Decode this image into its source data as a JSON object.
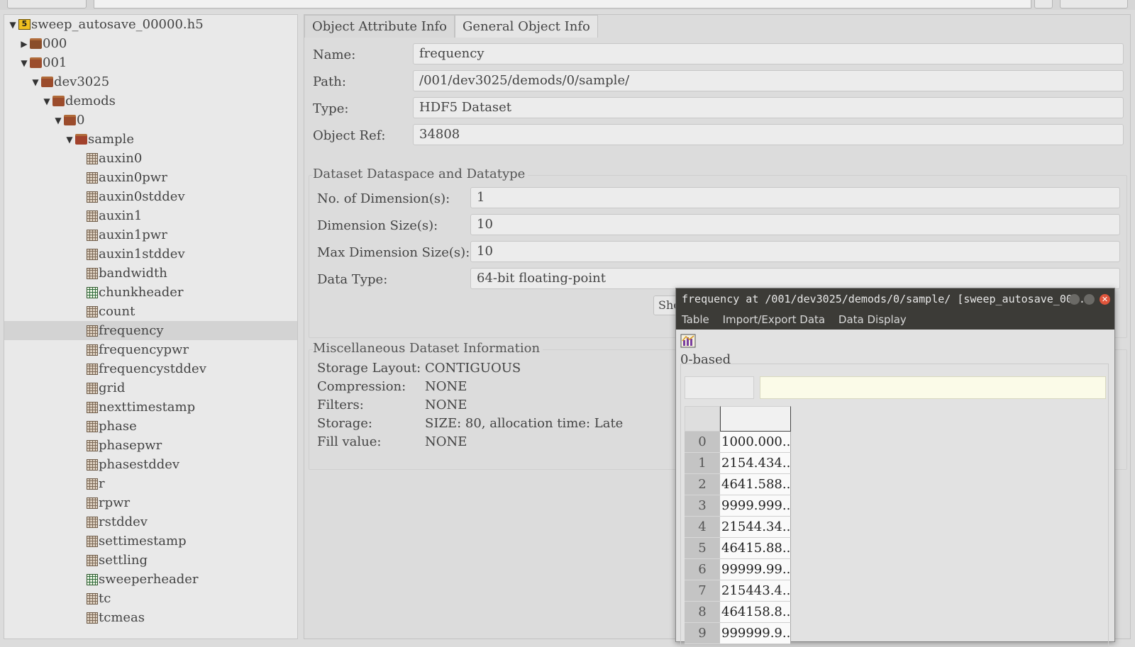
{
  "tree": {
    "root": "sweep_autosave_00000.h5",
    "items": [
      {
        "label": "000"
      },
      {
        "label": "001"
      },
      {
        "label": "dev3025"
      },
      {
        "label": "demods"
      },
      {
        "label": "0"
      },
      {
        "label": "sample"
      },
      {
        "label": "auxin0"
      },
      {
        "label": "auxin0pwr"
      },
      {
        "label": "auxin0stddev"
      },
      {
        "label": "auxin1"
      },
      {
        "label": "auxin1pwr"
      },
      {
        "label": "auxin1stddev"
      },
      {
        "label": "bandwidth"
      },
      {
        "label": "chunkheader"
      },
      {
        "label": "count"
      },
      {
        "label": "frequency"
      },
      {
        "label": "frequencypwr"
      },
      {
        "label": "frequencystddev"
      },
      {
        "label": "grid"
      },
      {
        "label": "nexttimestamp"
      },
      {
        "label": "phase"
      },
      {
        "label": "phasepwr"
      },
      {
        "label": "phasestddev"
      },
      {
        "label": "r"
      },
      {
        "label": "rpwr"
      },
      {
        "label": "rstddev"
      },
      {
        "label": "settimestamp"
      },
      {
        "label": "settling"
      },
      {
        "label": "sweeperheader"
      },
      {
        "label": "tc"
      },
      {
        "label": "tcmeas"
      }
    ]
  },
  "tabs": [
    "Object Attribute Info",
    "General Object Info"
  ],
  "object": {
    "name_label": "Name:",
    "name_value": "frequency",
    "path_label": "Path:",
    "path_value": "/001/dev3025/demods/0/sample/",
    "type_label": "Type:",
    "type_value": "HDF5 Dataset",
    "ref_label": "Object Ref:",
    "ref_value": "34808"
  },
  "dataspace": {
    "title": "Dataset Dataspace and Datatype",
    "ndims_label": "No. of Dimension(s):",
    "ndims_value": "1",
    "dims_label": "Dimension Size(s):",
    "dims_value": "10",
    "maxdims_label": "Max Dimension Size(s):",
    "maxdims_value": "10",
    "dtype_label": "Data Type:",
    "dtype_value": "64-bit floating-point",
    "show_button": "Sho"
  },
  "misc": {
    "title": "Miscellaneous Dataset Information",
    "layout_label": "Storage Layout:",
    "layout_value": "CONTIGUOUS",
    "compression_label": "Compression:",
    "compression_value": "NONE",
    "filters_label": "Filters:",
    "filters_value": "NONE",
    "storage_label": "Storage:",
    "storage_value": "SIZE: 80, allocation time: Late",
    "fill_label": "Fill value:",
    "fill_value": "NONE"
  },
  "window": {
    "title": "frequency  at  /001/dev3025/demods/0/sample/  [sweep_autosave_00...",
    "menu": [
      "Table",
      "Import/Export Data",
      "Data Display"
    ],
    "base_label": "0-based",
    "rows": [
      {
        "index": "0",
        "value": "1000.000..."
      },
      {
        "index": "1",
        "value": "2154.434..."
      },
      {
        "index": "2",
        "value": "4641.588..."
      },
      {
        "index": "3",
        "value": "9999.999..."
      },
      {
        "index": "4",
        "value": "21544.34..."
      },
      {
        "index": "5",
        "value": "46415.88..."
      },
      {
        "index": "6",
        "value": "99999.99..."
      },
      {
        "index": "7",
        "value": "215443.4..."
      },
      {
        "index": "8",
        "value": "464158.8..."
      },
      {
        "index": "9",
        "value": "999999.9..."
      }
    ]
  }
}
